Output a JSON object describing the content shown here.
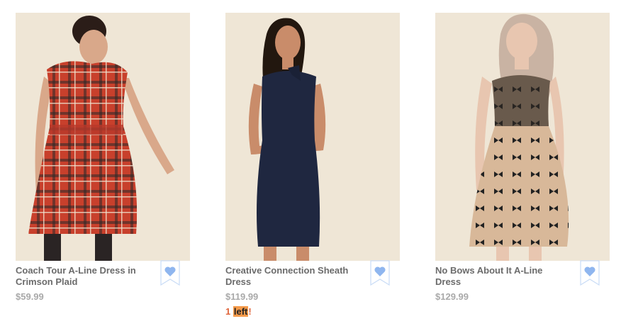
{
  "products": [
    {
      "name": "Coach Tour A-Line Dress in Crimson Plaid",
      "price": "$59.99",
      "image_icon": "dress-photo-red-plaid",
      "wishlist_icon": "heart-icon"
    },
    {
      "name": "Creative Connection Sheath Dress",
      "price": "$119.99",
      "stock_count": "1",
      "stock_word": "left",
      "stock_suffix": "!",
      "image_icon": "dress-photo-navy-sheath",
      "wishlist_icon": "heart-icon"
    },
    {
      "name": "No Bows About It A-Line Dress",
      "price": "$129.99",
      "image_icon": "dress-photo-bow-tulle",
      "wishlist_icon": "heart-icon"
    }
  ],
  "colors": {
    "photo_bg": "#efe6d6",
    "name_text": "#6b6b6b",
    "price_text": "#a9a9a9",
    "wishlist_blue": "#8fb6ef",
    "stock_orange": "#e0643a"
  }
}
